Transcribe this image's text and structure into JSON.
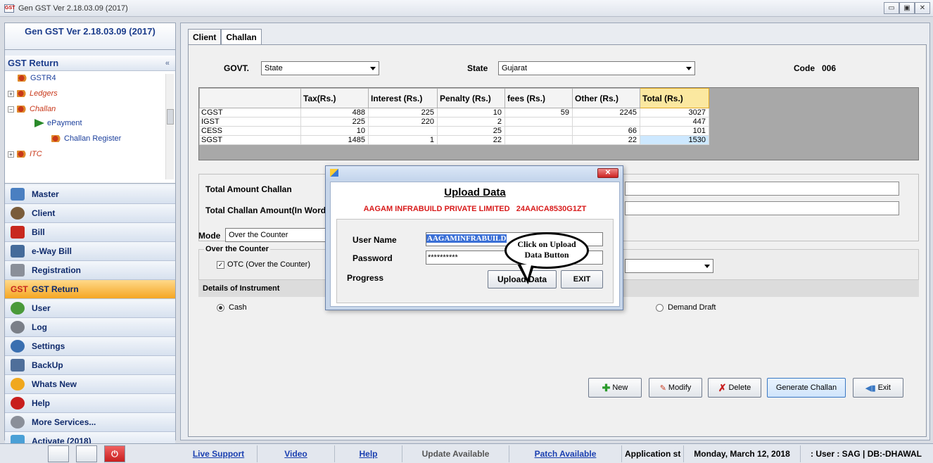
{
  "window": {
    "title": "Gen GST Ver 2.18.03.09 (2017)",
    "buttons": [
      "▭",
      "▣",
      "✕"
    ]
  },
  "sidebar": {
    "app_name": "Gen GST  Ver 2.18.03.09 (2017)",
    "section_title": "GST Return",
    "collapse": "«",
    "tree": [
      {
        "label": "GSTR4"
      },
      {
        "label": "Ledgers"
      },
      {
        "label": "Challan"
      },
      {
        "label": "ePayment"
      },
      {
        "label": "Challan Register"
      },
      {
        "label": "ITC"
      }
    ],
    "menu": [
      {
        "label": "Master",
        "color": "#4a7fc1"
      },
      {
        "label": "Client",
        "color": "#7a5c3a"
      },
      {
        "label": "Bill",
        "color": "#c8281e"
      },
      {
        "label": "e-Way Bill",
        "color": "#456b9a"
      },
      {
        "label": "Registration",
        "color": "#8a8f99"
      },
      {
        "label": "GST Return",
        "color": "#c8281e"
      },
      {
        "label": "User",
        "color": "#4a9a3a"
      },
      {
        "label": "Log",
        "color": "#7a7f88"
      },
      {
        "label": "Settings",
        "color": "#3a6fb0"
      },
      {
        "label": "BackUp",
        "color": "#4f6f9a"
      },
      {
        "label": "Whats New",
        "color": "#f0a81e"
      },
      {
        "label": "Help",
        "color": "#c81e1e"
      },
      {
        "label": "More Services...",
        "color": "#8a8f99"
      },
      {
        "label": "Activate (2018)",
        "color": "#4aa0d6"
      }
    ],
    "gst_badge": "GST"
  },
  "tabs": [
    {
      "label": "Client"
    },
    {
      "label": "Challan"
    }
  ],
  "form": {
    "govt_label": "GOVT.",
    "govt_value": "State",
    "state_label": "State",
    "state_value": "Gujarat",
    "code_label": "Code",
    "code_value": "006",
    "total_amount_label": "Total Amount Challan",
    "total_words_label": "Total Challan Amount(In Words",
    "mode_label": "Mode",
    "mode_value": "Over the Counter",
    "otc_group": "Over the Counter",
    "otc_check": "OTC (Over the Counter)",
    "instrument_label": "Details of Instrument",
    "cash_label": "Cash",
    "dd_label": "Demand Draft"
  },
  "table": {
    "headers": [
      "",
      "Tax(Rs.)",
      "Interest (Rs.)",
      "Penalty (Rs.)",
      "fees (Rs.)",
      "Other (Rs.)",
      "Total (Rs.)"
    ],
    "rows": [
      [
        "CGST",
        "488",
        "225",
        "10",
        "59",
        "2245",
        "3027"
      ],
      [
        "IGST",
        "225",
        "220",
        "2",
        "",
        "",
        "447"
      ],
      [
        "CESS",
        "10",
        "",
        "25",
        "",
        "66",
        "101"
      ],
      [
        "SGST",
        "1485",
        "1",
        "22",
        "",
        "22",
        "1530"
      ]
    ]
  },
  "dialog": {
    "title": "Upload Data",
    "company": "AAGAM INFRABUILD PRIVATE LIMITED   24AAICA8530G1ZT",
    "username_label": "User Name",
    "username_value": "AAGAMINFRABUILD",
    "password_label": "Password",
    "password_value": "**********",
    "progress_label": "Progress",
    "upload_button": "Upload Data",
    "exit_button": "EXIT",
    "close": "✕"
  },
  "callout": {
    "line1": "Click on Upload",
    "line2": "Data Button"
  },
  "actions": {
    "new": "New",
    "modify": "Modify",
    "delete": "Delete",
    "generate": "Generate Challan",
    "exit": "Exit"
  },
  "statusbar": {
    "live_support": "Live Support",
    "video": "Video",
    "help": "Help",
    "update": "Update Available",
    "patch": "Patch Available",
    "app_status": "Application st",
    "date": "Monday, March 12, 2018",
    "user": ": User : SAG | DB:-DHAWAL"
  }
}
